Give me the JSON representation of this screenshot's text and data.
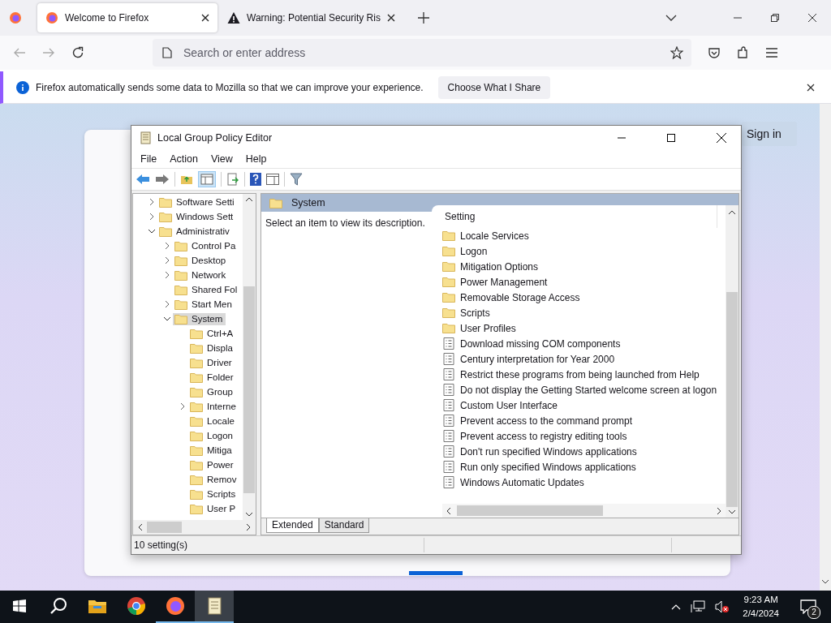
{
  "browser": {
    "tabs": [
      {
        "kind": "firefox",
        "title": "Welcome to Firefox",
        "selected": true
      },
      {
        "kind": "warning",
        "title": "Warning: Potential Security Ris",
        "selected": false
      }
    ],
    "address_bar": {
      "placeholder": "Search or enter address"
    },
    "notification": {
      "text": "Firefox automatically sends some data to Mozilla so that we can improve your experience.",
      "button": "Choose What I Share"
    },
    "page": {
      "sign_in": "Sign in"
    }
  },
  "editor": {
    "title": "Local Group Policy Editor",
    "menu": [
      "File",
      "Action",
      "View",
      "Help"
    ],
    "tree": [
      {
        "label": "Software Setti",
        "expanded": false,
        "selected": false
      },
      {
        "label": "Windows Sett",
        "expanded": false,
        "selected": false
      },
      {
        "label": "Administrativ",
        "expanded": true,
        "selected": false,
        "children": [
          {
            "label": "Control Pa",
            "expanded": false,
            "selected": false
          },
          {
            "label": "Desktop",
            "expanded": false,
            "selected": false
          },
          {
            "label": "Network",
            "expanded": false,
            "selected": false
          },
          {
            "label": "Shared Fol",
            "selected": false
          },
          {
            "label": "Start Men",
            "expanded": false,
            "selected": false
          },
          {
            "label": "System",
            "expanded": true,
            "selected": true,
            "children": [
              {
                "label": "Ctrl+A",
                "selected": false
              },
              {
                "label": "Displa",
                "selected": false
              },
              {
                "label": "Driver",
                "selected": false
              },
              {
                "label": "Folder",
                "selected": false
              },
              {
                "label": "Group",
                "selected": false
              },
              {
                "label": "Interne",
                "expanded": false,
                "selected": false
              },
              {
                "label": "Locale",
                "selected": false
              },
              {
                "label": "Logon",
                "selected": false
              },
              {
                "label": "Mitiga",
                "selected": false
              },
              {
                "label": "Power",
                "selected": false
              },
              {
                "label": "Remov",
                "selected": false
              },
              {
                "label": "Scripts",
                "selected": false
              },
              {
                "label": "User P",
                "selected": false
              }
            ]
          }
        ]
      }
    ],
    "details": {
      "header": "System",
      "description": "Select an item to view its description.",
      "column": "Setting",
      "settings": [
        {
          "kind": "folder",
          "name": "Locale Services"
        },
        {
          "kind": "folder",
          "name": "Logon"
        },
        {
          "kind": "folder",
          "name": "Mitigation Options"
        },
        {
          "kind": "folder",
          "name": "Power Management"
        },
        {
          "kind": "folder",
          "name": "Removable Storage Access"
        },
        {
          "kind": "folder",
          "name": "Scripts"
        },
        {
          "kind": "folder",
          "name": "User Profiles"
        },
        {
          "kind": "policy",
          "name": "Download missing COM components"
        },
        {
          "kind": "policy",
          "name": "Century interpretation for Year 2000"
        },
        {
          "kind": "policy",
          "name": "Restrict these programs from being launched from Help"
        },
        {
          "kind": "policy",
          "name": "Do not display the Getting Started welcome screen at logon"
        },
        {
          "kind": "policy",
          "name": "Custom User Interface"
        },
        {
          "kind": "policy",
          "name": "Prevent access to the command prompt"
        },
        {
          "kind": "policy",
          "name": "Prevent access to registry editing tools"
        },
        {
          "kind": "policy",
          "name": "Don't run specified Windows applications"
        },
        {
          "kind": "policy",
          "name": "Run only specified Windows applications"
        },
        {
          "kind": "policy",
          "name": "Windows Automatic Updates"
        }
      ]
    },
    "view_tabs": [
      {
        "label": "Extended",
        "selected": true
      },
      {
        "label": "Standard",
        "selected": false
      }
    ],
    "status": "10 setting(s)"
  },
  "taskbar": {
    "apps": [
      {
        "kind": "explorer",
        "running": false,
        "active": false
      },
      {
        "kind": "chrome",
        "running": false,
        "active": false
      },
      {
        "kind": "firefox",
        "running": true,
        "active": false
      },
      {
        "kind": "notepad",
        "running": true,
        "active": true
      }
    ],
    "time": "9:23 AM",
    "date": "2/4/2024",
    "notifications": "2"
  }
}
